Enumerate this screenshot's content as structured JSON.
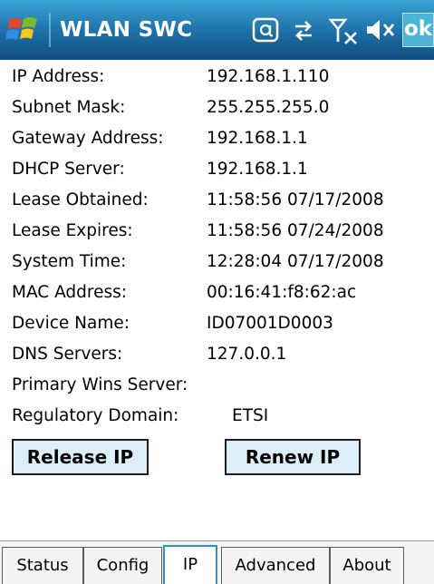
{
  "titlebar": {
    "title": "WLAN SWC",
    "ok_label": "ok",
    "icons": [
      "windows-start-icon",
      "at-icon",
      "connectivity-icon",
      "no-signal-icon",
      "speaker-mute-icon"
    ]
  },
  "info": [
    {
      "label": "IP Address:",
      "value": "192.168.1.110"
    },
    {
      "label": "Subnet Mask:",
      "value": "255.255.255.0"
    },
    {
      "label": "Gateway Address:",
      "value": "192.168.1.1"
    },
    {
      "label": "DHCP Server:",
      "value": "192.168.1.1"
    },
    {
      "label": "Lease Obtained:",
      "value": "11:58:56 07/17/2008"
    },
    {
      "label": "Lease Expires:",
      "value": "11:58:56 07/24/2008"
    },
    {
      "label": "System Time:",
      "value": "12:28:04 07/17/2008"
    },
    {
      "label": "MAC Address:",
      "value": "00:16:41:f8:62:ac"
    },
    {
      "label": "Device Name:",
      "value": "ID07001D0003"
    },
    {
      "label": "DNS Servers:",
      "value": "127.0.0.1"
    },
    {
      "label": "Primary Wins Server:",
      "value": ""
    },
    {
      "label": "Regulatory Domain:",
      "value": "ETSI"
    }
  ],
  "buttons": {
    "release": "Release IP",
    "renew": "Renew IP"
  },
  "tabs": [
    {
      "label": "Status",
      "active": false
    },
    {
      "label": "Config",
      "active": false
    },
    {
      "label": "IP",
      "active": true
    },
    {
      "label": "Advanced",
      "active": false
    },
    {
      "label": "About",
      "active": false
    }
  ],
  "colors": {
    "titlebar_top": "#3aa4d6",
    "titlebar_bottom": "#0f4d7c",
    "button_face": "#dceff8",
    "active_tab_border": "#2f8fc2"
  }
}
